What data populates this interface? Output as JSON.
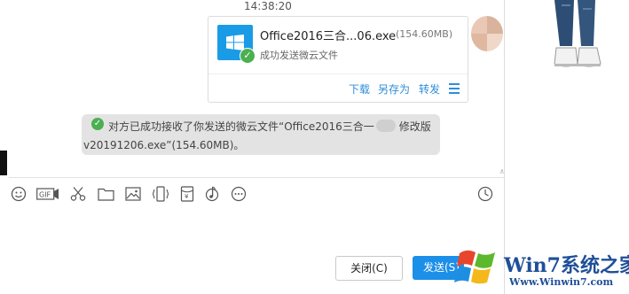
{
  "chat": {
    "timestamp": "14:38:20",
    "file_card": {
      "file_name": "Office2016三合...06.exe",
      "file_size": "(154.60MB)",
      "status": "成功发送微云文件",
      "actions": {
        "download": "下载",
        "save_as": "另存为",
        "forward": "转发"
      }
    },
    "notice": {
      "line1": "对方已成功接收了你发送的微云文件“Office2016三合一",
      "line1_tail": "修改版",
      "line2": "v20191206.exe”(154.60MB)。"
    }
  },
  "toolbar": {
    "icons": [
      "emoji-icon",
      "gif-icon",
      "scissors-icon",
      "folder-icon",
      "image-icon",
      "shake-icon",
      "red-packet-icon",
      "music-icon",
      "more-icon",
      "history-icon"
    ],
    "gif_label": "GIF"
  },
  "buttons": {
    "close": "关闭(C)",
    "send": "发送(S)"
  },
  "watermark": {
    "title": "Win7系统之家",
    "url": "Www.Winwin7.com"
  },
  "colors": {
    "accent": "#1c8fe8",
    "success": "#4caf50",
    "file_icon_bg": "#1a9be6",
    "watermark": "#1e4f98"
  }
}
